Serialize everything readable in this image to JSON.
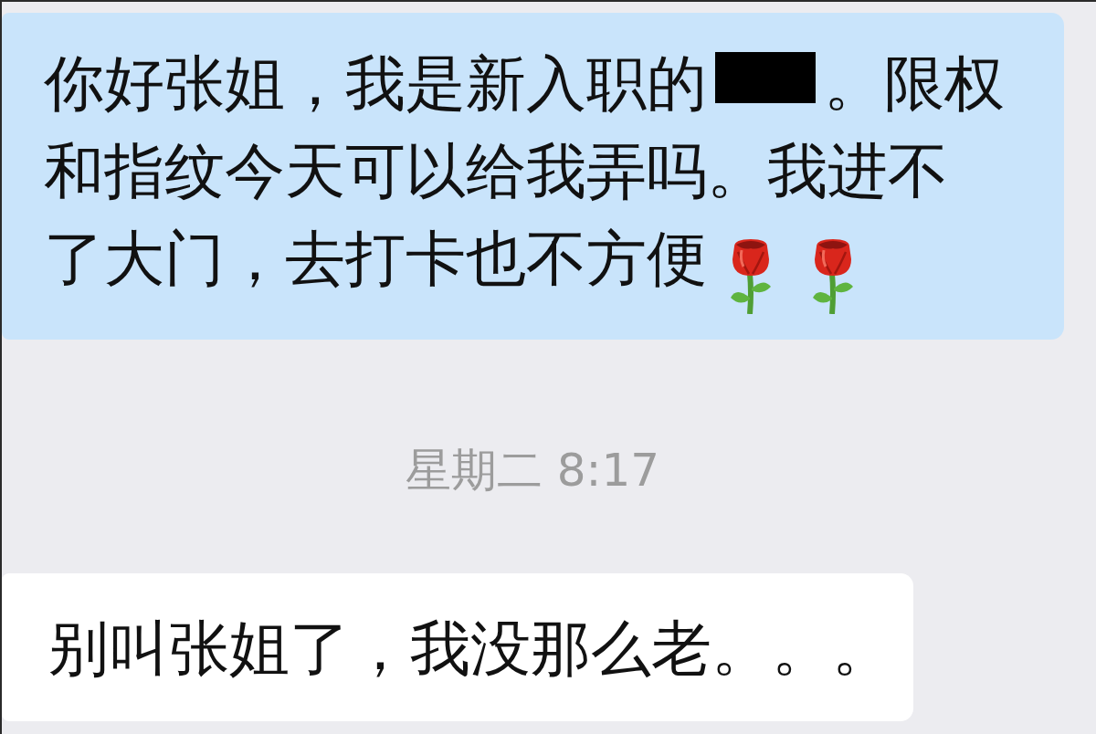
{
  "messages": [
    {
      "kind": "outgoing",
      "lines": [
        [
          {
            "kind": "text",
            "text": "你好张姐，我是新入职的"
          },
          {
            "kind": "redaction"
          },
          {
            "kind": "text",
            "text": "。限权"
          }
        ],
        [
          {
            "kind": "text",
            "text": "和指纹今天可以给我弄吗。我进不"
          }
        ],
        [
          {
            "kind": "text",
            "text": "了大门，去打卡也不方便"
          },
          {
            "kind": "emoji"
          },
          {
            "kind": "emoji"
          }
        ]
      ]
    },
    {
      "kind": "timestamp",
      "text": "星期二 8:17"
    },
    {
      "kind": "incoming",
      "lines": [
        [
          {
            "kind": "text",
            "text": "别叫张姐了，我没那么老。。。"
          }
        ]
      ]
    }
  ]
}
